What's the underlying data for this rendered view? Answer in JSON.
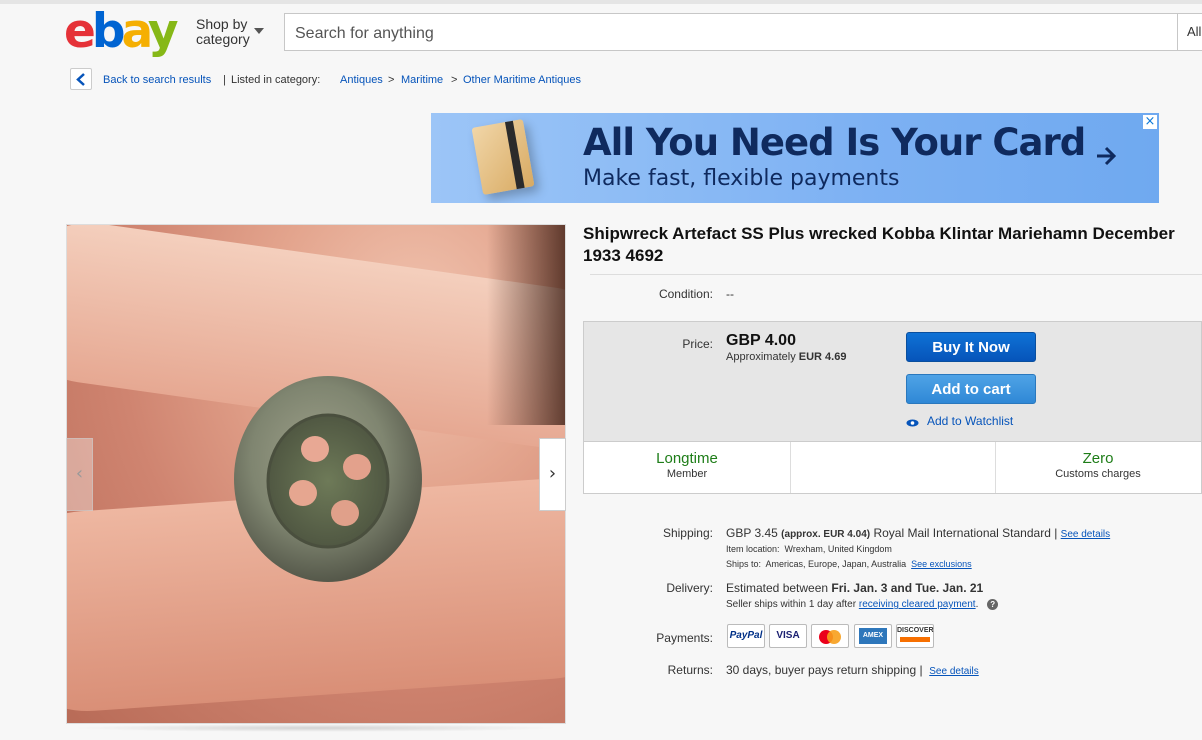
{
  "header": {
    "logo": {
      "e": "e",
      "b": "b",
      "a": "a",
      "y": "y"
    },
    "shop_by_line1": "Shop by",
    "shop_by_line2": "category",
    "search_placeholder": "Search for anything",
    "search_category": "All"
  },
  "breadcrumb": {
    "back_label": "Back to search results",
    "separator": "|",
    "listed_in": "Listed in category:",
    "items": [
      "Antiques",
      "Maritime",
      "Other Maritime Antiques"
    ],
    "chevron": ">"
  },
  "ad": {
    "headline": "All You Need Is Your Card",
    "subline": "Make fast, flexible payments",
    "close": "×"
  },
  "gallery": {
    "prev": "‹",
    "next": "›"
  },
  "listing": {
    "title": "Shipwreck Artefact SS Plus wrecked Kobba Klintar Mariehamn December 1933 4692",
    "condition_label": "Condition:",
    "condition_value": "--",
    "price_label": "Price:",
    "price": "GBP 4.00",
    "price_approx_prefix": "Approximately",
    "price_approx": "EUR 4.69",
    "buy_now": "Buy It Now",
    "add_to_cart": "Add to cart",
    "watchlist": "Add to Watchlist",
    "badges": [
      {
        "big": "Longtime",
        "small": "Member",
        "color": "#1e7d18"
      },
      {
        "big": "",
        "small": ""
      },
      {
        "big": "Zero",
        "small": "Customs charges",
        "color": "#1e7d18"
      }
    ],
    "shipping_label": "Shipping:",
    "shipping_price": "GBP 3.45",
    "shipping_approx": "(approx. EUR 4.04)",
    "shipping_service": "Royal Mail International Standard |",
    "see_details": "See details",
    "item_location_label": "Item location:",
    "item_location": "Wrexham, United Kingdom",
    "ships_to_label": "Ships to:",
    "ships_to": "Americas, Europe, Japan, Australia",
    "see_exclusions": "See exclusions",
    "delivery_label": "Delivery:",
    "delivery_prefix": "Estimated between",
    "delivery_dates": "Fri. Jan. 3 and Tue. Jan. 21",
    "delivery_note_prefix": "Seller ships within 1 day after",
    "delivery_note_link": "receiving cleared payment",
    "delivery_note_suffix": ".",
    "help_icon_text": "?",
    "payments_label": "Payments:",
    "payment_methods": [
      "PayPal",
      "VISA",
      "MasterCard",
      "AMEX",
      "DISCOVER"
    ],
    "returns_label": "Returns:",
    "returns_value": "30 days, buyer pays return shipping |",
    "returns_link": "See details"
  },
  "colors": {
    "accent_blue": "#0654ba",
    "buy_blue": "#0654ba",
    "cart_blue": "#3d93de",
    "green": "#1e7d18"
  }
}
